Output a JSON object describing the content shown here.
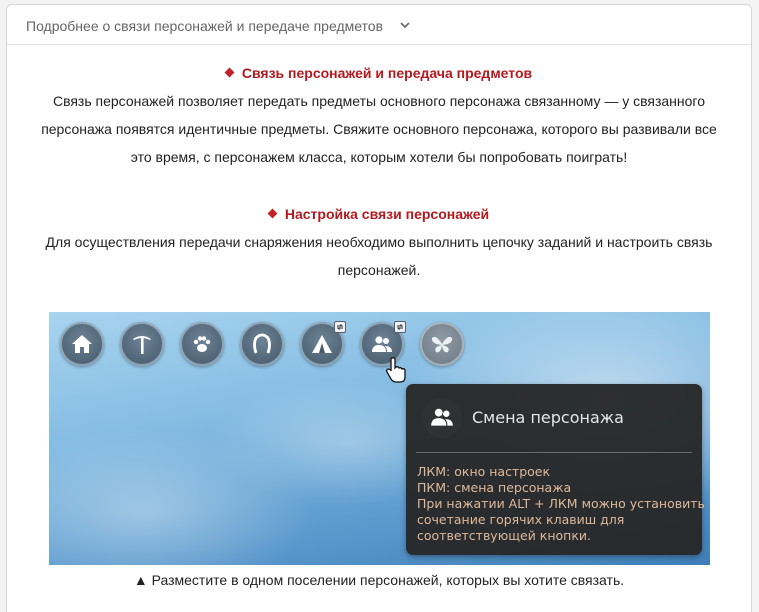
{
  "accordion": {
    "title": "Подробнее о связи персонажей и передаче предметов"
  },
  "sections": [
    {
      "title": "Связь персонажей и передача предметов",
      "lines": [
        "Связь персонажей позволяет передать предметы основного персонажа связанному — у связанного",
        "персонажа появятся идентичные предметы. Свяжите основного персонажа, которого вы развивали все",
        "это время, с персонажем класса, которым хотели бы попробовать поиграть!"
      ]
    },
    {
      "title": "Настройка связи персонажей",
      "lines": [
        "Для осуществления передачи снаряжения необходимо выполнить цепочку заданий и настроить связь",
        "персонажей."
      ]
    }
  ],
  "screenshot": {
    "hud_icons": [
      "house-icon",
      "pickaxe-icon",
      "paw-icon",
      "horseshoe-icon",
      "tent-icon",
      "two-people-icon",
      "butterfly-icon"
    ],
    "tooltip": {
      "title": "Смена персонажа",
      "lines": [
        "ЛКМ: окно настроек",
        "ПКМ: смена персонажа",
        "При нажатии ALT + ЛКМ можно установить",
        "сочетание горячих клавиш для",
        "соответствующей кнопки."
      ]
    }
  },
  "caption": "▲ Разместите в одном поселении персонажей, которых вы хотите связать.",
  "colors": {
    "accent": "#b3191e",
    "tooltip_text": "#e0b89a"
  }
}
